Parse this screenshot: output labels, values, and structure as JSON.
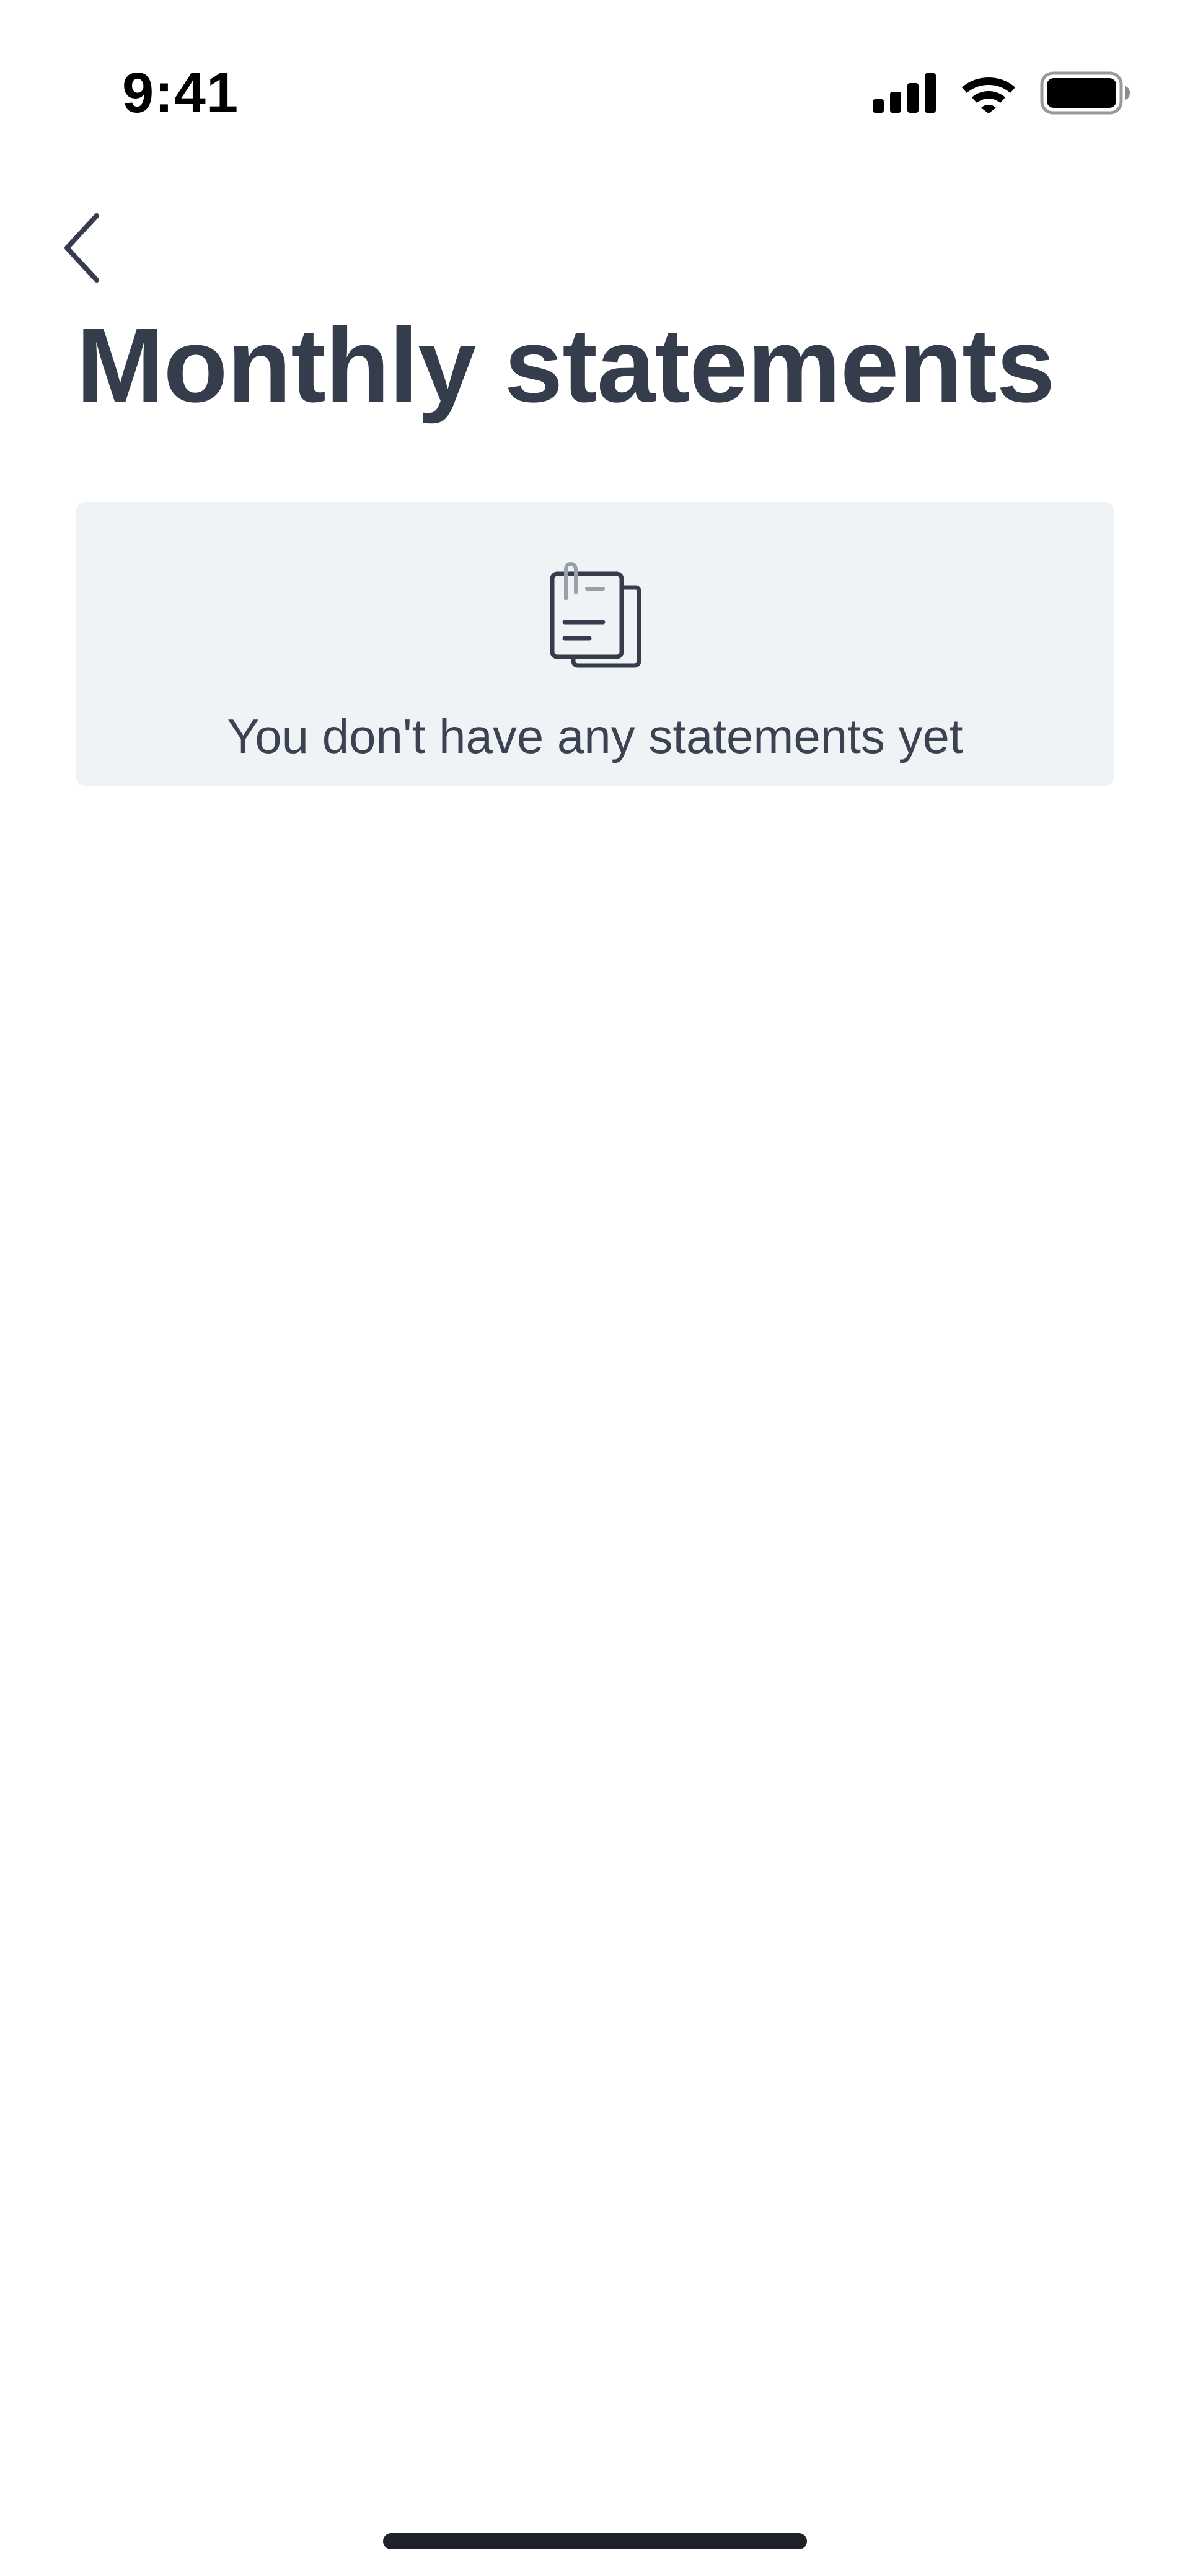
{
  "status_bar": {
    "time": "9:41",
    "icons": [
      "cellular-signal-icon",
      "wifi-icon",
      "battery-icon"
    ]
  },
  "header": {
    "back_icon": "chevron-left-icon",
    "title": "Monthly statements"
  },
  "empty_state": {
    "icon": "documents-icon",
    "message": "You don't have any statements yet"
  },
  "colors": {
    "text_primary": "#353d4d",
    "card_background": "#f0f3f6",
    "page_background": "#ffffff",
    "home_indicator": "#1f2229"
  }
}
